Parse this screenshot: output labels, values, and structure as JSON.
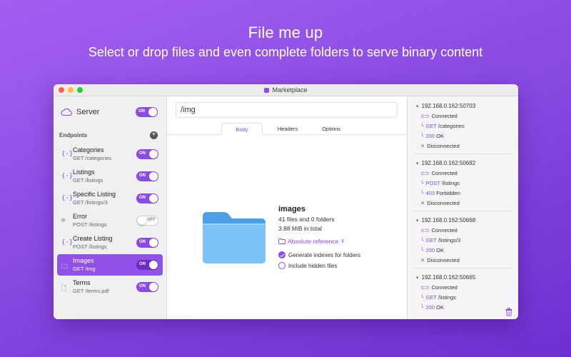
{
  "headline": "File me up",
  "subheadline": "Select or drop files and even complete folders to serve binary content",
  "window": {
    "title": "Marketplace"
  },
  "sidebar": {
    "server_label": "Server",
    "server_toggle": "ON",
    "endpoints_header": "Endpoints",
    "endpoints": [
      {
        "name": "Categories",
        "route": "GET /categories",
        "icon": "{·}",
        "toggle": "ON"
      },
      {
        "name": "Listings",
        "route": "GET /listings",
        "icon": "{·}",
        "toggle": "ON"
      },
      {
        "name": "Specific Listing",
        "route": "GET /listings/3",
        "icon": "{·}",
        "toggle": "ON"
      },
      {
        "name": "Error",
        "route": "POST /listings",
        "icon": "⊘",
        "toggle": "OFF"
      },
      {
        "name": "Create Listing",
        "route": "POST /listings",
        "icon": "{·}",
        "toggle": "ON"
      },
      {
        "name": "Images",
        "route": "GET /img",
        "icon": "🗀",
        "toggle": "ON"
      },
      {
        "name": "Terms",
        "route": "GET /terms.pdf",
        "icon": "🗋",
        "toggle": "ON"
      }
    ]
  },
  "main": {
    "path": "/img",
    "tabs": [
      "Body",
      "Headers",
      "Options"
    ],
    "folder": {
      "name": "images",
      "counts": "41 files and 0 folders",
      "size": "3.88 MiB in total",
      "reference": "Absolute reference",
      "opt_indexes": "Generate indexes for folders",
      "opt_hidden": "Include hidden files"
    }
  },
  "connections": [
    {
      "address": "192.168.0.162:50703",
      "events": [
        {
          "icon": "⊂⊃",
          "text": "Connected"
        },
        {
          "icon": "╰",
          "method": "GET",
          "text": " /categories"
        },
        {
          "icon": "╰",
          "method": "200",
          "text": " OK"
        },
        {
          "icon": "✕",
          "text": "Disconnected"
        }
      ]
    },
    {
      "address": "192.168.0.162:50692",
      "events": [
        {
          "icon": "⊂⊃",
          "text": "Connected"
        },
        {
          "icon": "╰",
          "method": "POST",
          "text": " /listings"
        },
        {
          "icon": "╰",
          "method": "403",
          "text": " Forbidden"
        },
        {
          "icon": "✕",
          "text": "Disconnected"
        }
      ]
    },
    {
      "address": "192.168.0.162:50668",
      "events": [
        {
          "icon": "⊂⊃",
          "text": "Connected"
        },
        {
          "icon": "╰",
          "method": "GET",
          "text": " /listings/3"
        },
        {
          "icon": "╰",
          "method": "200",
          "text": " OK"
        },
        {
          "icon": "✕",
          "text": "Disconnected"
        }
      ]
    },
    {
      "address": "192.168.0.162:50665",
      "events": [
        {
          "icon": "⊂⊃",
          "text": "Connected"
        },
        {
          "icon": "╰",
          "method": "GET",
          "text": " /listings"
        },
        {
          "icon": "╰",
          "method": "200",
          "text": " OK"
        }
      ]
    }
  ],
  "colors": {
    "accent": "#8a4ae3",
    "background_top": "#a35ff0",
    "background_bottom": "#6f2fd0"
  }
}
